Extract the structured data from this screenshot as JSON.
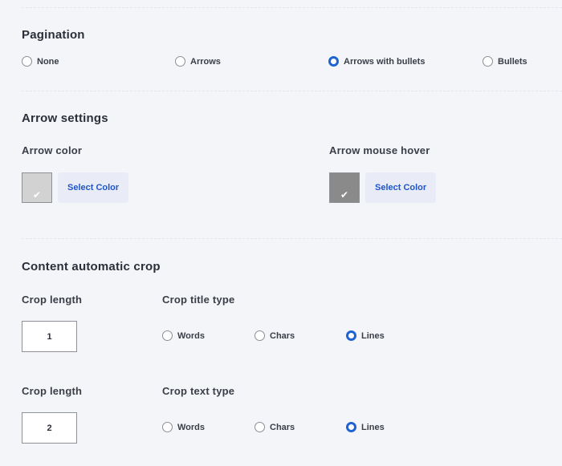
{
  "pagination": {
    "title": "Pagination",
    "options": [
      "None",
      "Arrows",
      "Arrows with bullets",
      "Bullets"
    ],
    "selected": "Arrows with bullets"
  },
  "arrow_settings": {
    "title": "Arrow settings",
    "arrow_color": {
      "label": "Arrow color",
      "swatch_color": "#d2d2d2",
      "button_label": "Select Color"
    },
    "arrow_hover": {
      "label": "Arrow mouse hover",
      "swatch_color": "#8a8a8a",
      "button_label": "Select Color"
    }
  },
  "content_crop": {
    "title": "Content automatic crop",
    "title_crop": {
      "length_label": "Crop length",
      "length_value": "1",
      "type_label": "Crop title type",
      "options": [
        "Words",
        "Chars",
        "Lines"
      ],
      "selected": "Lines"
    },
    "text_crop": {
      "length_label": "Crop length",
      "length_value": "2",
      "type_label": "Crop text type",
      "options": [
        "Words",
        "Chars",
        "Lines"
      ],
      "selected": "Lines"
    }
  },
  "colors": {
    "accent": "#1f63d3",
    "link": "#1f55c8",
    "background": "#f4f5f9"
  }
}
